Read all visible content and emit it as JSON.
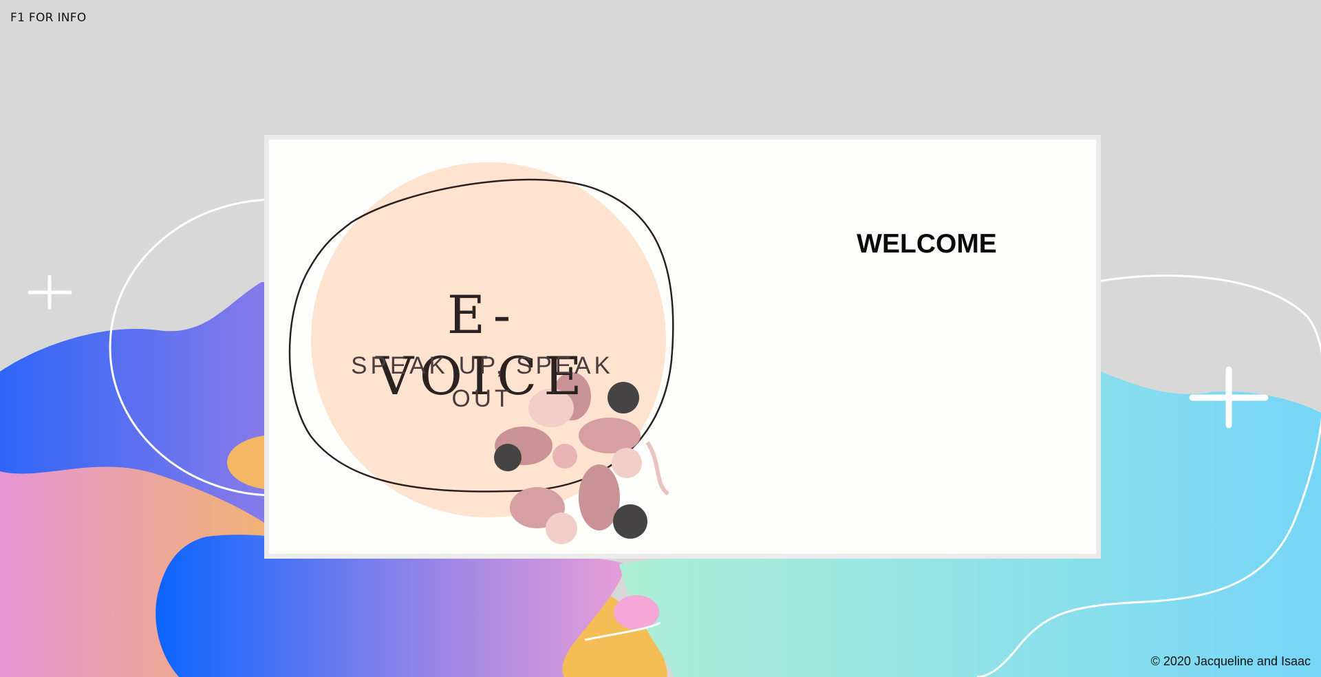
{
  "hint": {
    "text": "F1 FOR INFO"
  },
  "logo": {
    "brand": "E-VOICE",
    "tagline": "SPEAK UP, SPEAK OUT"
  },
  "main": {
    "heading": "WELCOME"
  },
  "footer": {
    "copyright": "© 2020 Jacqueline and Isaac"
  },
  "colors": {
    "page_bg": "#d8d8d8",
    "card_bg": "#fdfdfb",
    "logo_circle": "#fde3d0",
    "blob_blue": "#3f6ff5",
    "blob_cyan": "#7fd9f5",
    "blob_pink": "#e89bd5",
    "blob_orange": "#f3b765"
  },
  "icons": [
    "plus-icon",
    "people-flower-icon"
  ]
}
